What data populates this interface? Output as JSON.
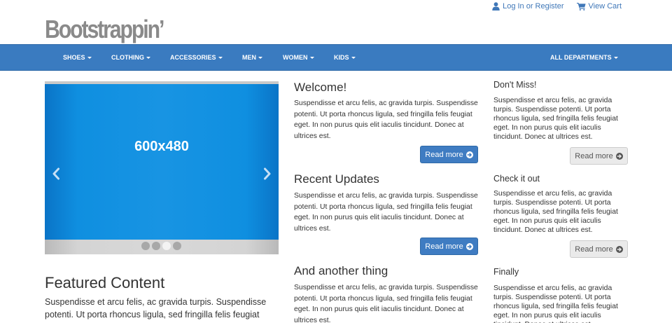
{
  "brand": {
    "logo_text": "Bootstrappin’"
  },
  "toplinks": {
    "login_label": "Log In or Register",
    "login_icon": "user-icon",
    "cart_label": "View Cart",
    "cart_icon": "cart-icon"
  },
  "nav": {
    "items": [
      "Shoes",
      "Clothing",
      "Accessories",
      "Men",
      "Women",
      "Kids"
    ],
    "right_item": "All Departments"
  },
  "carousel": {
    "slide_label": "600x480",
    "slide_count": 4,
    "active_index": 2,
    "prev_icon": "chevron-left-icon",
    "next_icon": "chevron-right-icon"
  },
  "featured": {
    "title": "Featured Content",
    "text": "Suspendisse et arcu felis, ac gravida turpis. Suspendisse potenti. Ut porta rhoncus ligula, sed fringilla felis feugiat"
  },
  "main_sections": [
    {
      "title": "Welcome!",
      "text": "Suspendisse et arcu felis, ac gravida turpis. Suspendisse potenti. Ut porta rhoncus ligula, sed fringilla felis feugiat eget. In non purus quis elit iaculis tincidunt. Donec at ultrices est.",
      "button": "Read more"
    },
    {
      "title": "Recent Updates",
      "text": "Suspendisse et arcu felis, ac gravida turpis. Suspendisse potenti. Ut porta rhoncus ligula, sed fringilla felis feugiat eget. In non purus quis elit iaculis tincidunt. Donec at ultrices est.",
      "button": "Read more"
    },
    {
      "title": "And another thing",
      "text": "Suspendisse et arcu felis, ac gravida turpis. Suspendisse potenti. Ut porta rhoncus ligula, sed fringilla felis feugiat eget. In non purus quis elit iaculis tincidunt. Donec at ultrices est."
    }
  ],
  "side_sections": [
    {
      "title": "Don't Miss!",
      "text": "Suspendisse et arcu felis, ac gravida turpis. Suspendisse potenti. Ut porta rhoncus ligula, sed fringilla felis feugiat eget. In non purus quis elit iaculis tincidunt. Donec at ultrices est.",
      "button": "Read more"
    },
    {
      "title": "Check it out",
      "text": "Suspendisse et arcu felis, ac gravida turpis. Suspendisse potenti. Ut porta rhoncus ligula, sed fringilla felis feugiat eget. In non purus quis elit iaculis tincidunt. Donec at ultrices est.",
      "button": "Read more"
    },
    {
      "title": "Finally",
      "text": "Suspendisse et arcu felis, ac gravida turpis. Suspendisse potenti. Ut porta rhoncus ligula, sed fringilla felis feugiat eget. In non purus quis elit iaculis tincidunt. Donec at ultrices est."
    }
  ],
  "colors": {
    "nav_bg": "#3a7bc0",
    "link": "#3f77b8",
    "primary_button": "#3f7cc2",
    "slide_blue": "#1894e3",
    "logo_gray": "#8a8a8a"
  }
}
